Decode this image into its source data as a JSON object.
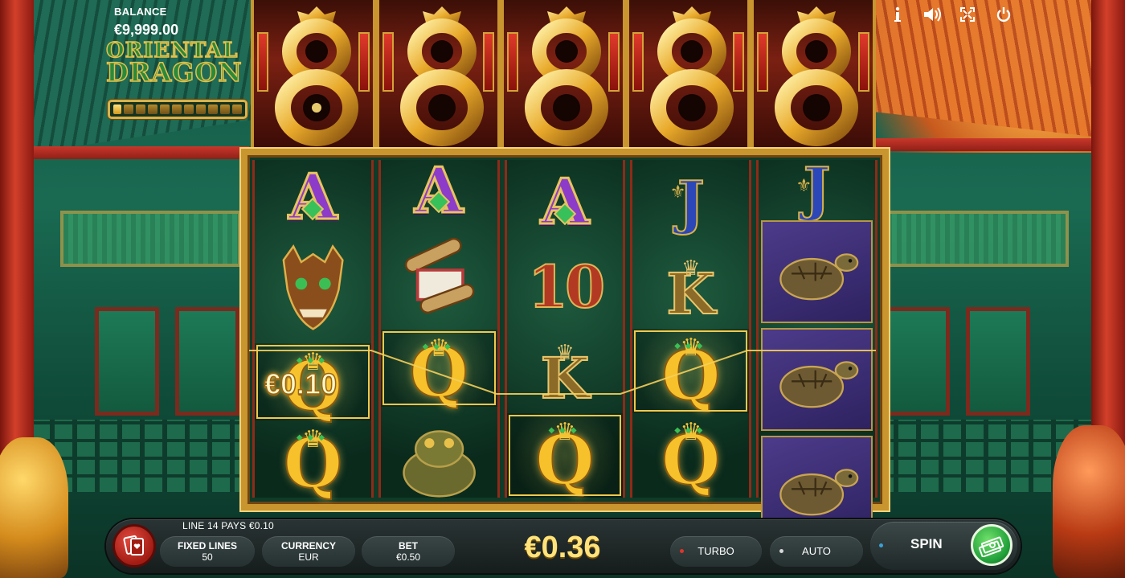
{
  "game": {
    "title_line1": "ORIENTAL",
    "title_line2": "DRAGON"
  },
  "balance": {
    "label": "BALANCE",
    "value": "€9,999.00"
  },
  "progress": {
    "filled_segments": 1,
    "total_segments": 11
  },
  "top_icons": [
    "info-icon",
    "sound-icon",
    "fullscreen-icon",
    "power-icon"
  ],
  "reels": [
    [
      "A",
      "dragon-mask",
      "Q",
      "Q"
    ],
    [
      "A",
      "scroll",
      "Q",
      "toad"
    ],
    [
      "A",
      "10",
      "K",
      "Q"
    ],
    [
      "J",
      "K",
      "Q",
      "Q"
    ],
    [
      "J",
      "turtle",
      "turtle",
      "turtle"
    ]
  ],
  "winning_positions": [
    [
      0,
      2
    ],
    [
      1,
      2
    ],
    [
      2,
      3
    ],
    [
      3,
      2
    ]
  ],
  "symbol_win": {
    "amount": "€0.10"
  },
  "bottom_bar": {
    "pays_text": "LINE 14 PAYS €0.10",
    "fixed_lines_label": "FIXED LINES",
    "fixed_lines_value": "50",
    "currency_label": "CURRENCY",
    "currency_value": "EUR",
    "bet_label": "BET",
    "bet_value": "€0.50",
    "total_win": "€0.36",
    "turbo_label": "TURBO",
    "auto_label": "AUTO",
    "spin_label": "SPIN"
  },
  "colors": {
    "gold": "#f1c84c",
    "accent_red": "#c9372a",
    "spin_green": "#22a23a"
  }
}
